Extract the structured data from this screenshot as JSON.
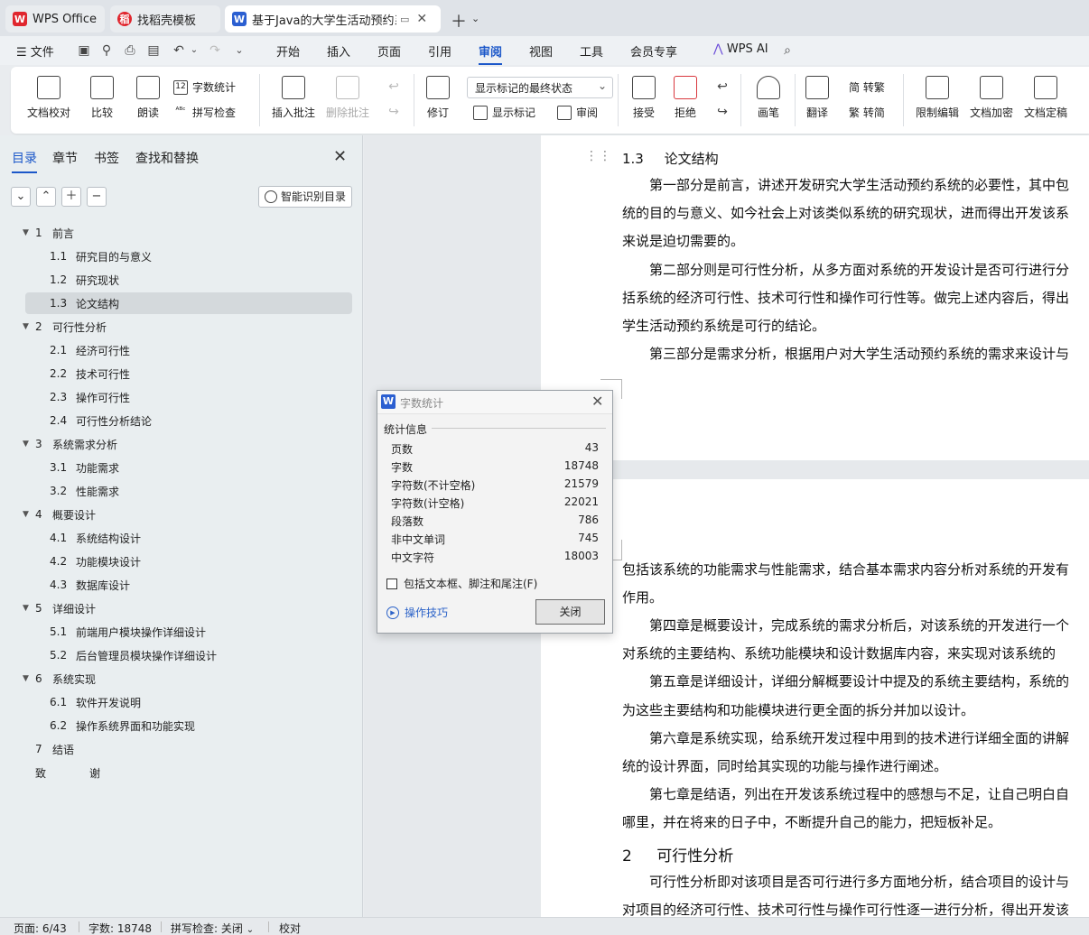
{
  "tabs": [
    {
      "label": "WPS Office",
      "icon": "wps-logo-icon"
    },
    {
      "label": "找稻壳模板",
      "icon": "docer-icon"
    },
    {
      "label": "基于Java的大学生活动预约系",
      "icon": "writer-doc-icon"
    }
  ],
  "menu": {
    "file": "文件",
    "items": [
      "开始",
      "插入",
      "页面",
      "引用",
      "审阅",
      "视图",
      "工具",
      "会员专享"
    ],
    "active": "审阅",
    "wps_ai": "WPS AI"
  },
  "ribbon": {
    "doc_check": "文档校对",
    "compare": "比较",
    "read_aloud": "朗读",
    "word_count": "字数统计",
    "spell_check": "拼写检查",
    "insert_comment": "插入批注",
    "delete_comment": "删除批注",
    "revise": "修订",
    "markup_select": "显示标记的最终状态",
    "show_markup": "显示标记",
    "review": "审阅",
    "accept": "接受",
    "reject": "拒绝",
    "pen": "画笔",
    "translate": "翻译",
    "to_traditional": "简 转繁",
    "to_simplified": "繁 转简",
    "restrict_edit": "限制编辑",
    "encrypt": "文档加密",
    "finalize": "文档定稿"
  },
  "nav": {
    "tabs": [
      "目录",
      "章节",
      "书签",
      "查找和替换"
    ],
    "smart_toc": "智能识别目录",
    "toc": [
      {
        "num": "1",
        "title": "前言",
        "level": 1,
        "expanded": true
      },
      {
        "num": "1.1",
        "title": "研究目的与意义",
        "level": 2
      },
      {
        "num": "1.2",
        "title": "研究现状",
        "level": 2
      },
      {
        "num": "1.3",
        "title": "论文结构",
        "level": 2,
        "selected": true
      },
      {
        "num": "2",
        "title": "可行性分析",
        "level": 1,
        "expanded": true
      },
      {
        "num": "2.1",
        "title": "经济可行性",
        "level": 2
      },
      {
        "num": "2.2",
        "title": "技术可行性",
        "level": 2
      },
      {
        "num": "2.3",
        "title": "操作可行性",
        "level": 2
      },
      {
        "num": "2.4",
        "title": "可行性分析结论",
        "level": 2
      },
      {
        "num": "3",
        "title": "系统需求分析",
        "level": 1,
        "expanded": true
      },
      {
        "num": "3.1",
        "title": "功能需求",
        "level": 2
      },
      {
        "num": "3.2",
        "title": "性能需求",
        "level": 2
      },
      {
        "num": "4",
        "title": "概要设计",
        "level": 1,
        "expanded": true
      },
      {
        "num": "4.1",
        "title": "系统结构设计",
        "level": 2
      },
      {
        "num": "4.2",
        "title": "功能模块设计",
        "level": 2
      },
      {
        "num": "4.3",
        "title": "数据库设计",
        "level": 2
      },
      {
        "num": "5",
        "title": "详细设计",
        "level": 1,
        "expanded": true
      },
      {
        "num": "5.1",
        "title": "前端用户模块操作详细设计",
        "level": 2
      },
      {
        "num": "5.2",
        "title": "后台管理员模块操作详细设计",
        "level": 2
      },
      {
        "num": "6",
        "title": "系统实现",
        "level": 1,
        "expanded": true
      },
      {
        "num": "6.1",
        "title": "软件开发说明",
        "level": 2
      },
      {
        "num": "6.2",
        "title": "操作系统界面和功能实现",
        "level": 2
      },
      {
        "num": "7",
        "title": "结语",
        "level": 1,
        "expanded": false
      },
      {
        "num": "致",
        "title": "谢",
        "level": 0
      }
    ]
  },
  "document": {
    "page1": {
      "heading": {
        "num": "1.3",
        "title": "论文结构"
      },
      "lines": [
        "　　第一部分是前言，讲述开发研究大学生活动预约系统的必要性，其中包",
        "统的目的与意义、如今社会上对该类似系统的研究现状，进而得出开发该系",
        "来说是迫切需要的。",
        "　　第二部分则是可行性分析，从多方面对系统的开发设计是否可行进行分",
        "括系统的经济可行性、技术可行性和操作可行性等。做完上述内容后，得出",
        "学生活动预约系统是可行的结论。",
        "　　第三部分是需求分析，根据用户对大学生活动预约系统的需求来设计与"
      ]
    },
    "page2": {
      "lines": [
        "包括该系统的功能需求与性能需求，结合基本需求内容分析对系统的开发有",
        "作用。",
        "　　第四章是概要设计，完成系统的需求分析后，对该系统的开发进行一个",
        "对系统的主要结构、系统功能模块和设计数据库内容，来实现对该系统的",
        "　　第五章是详细设计，详细分解概要设计中提及的系统主要结构，系统的",
        "为这些主要结构和功能模块进行更全面的拆分并加以设计。",
        "　　第六章是系统实现，给系统开发过程中用到的技术进行详细全面的讲解",
        "统的设计界面，同时给其实现的功能与操作进行阐述。",
        "　　第七章是结语，列出在开发该系统过程中的感想与不足，让自己明白自",
        "哪里，并在将来的日子中，不断提升自己的能力，把短板补足。"
      ],
      "heading": {
        "num": "2",
        "title": "可行性分析"
      },
      "after_lines": [
        "　　可行性分析即对该项目是否可行进行多方面地分析，结合项目的设计与",
        "对项目的经济可行性、技术可行性与操作可行性逐一进行分析，得出开发该"
      ]
    }
  },
  "dialog": {
    "title": "字数统计",
    "group": "统计信息",
    "stats": [
      {
        "label": "页数",
        "value": "43"
      },
      {
        "label": "字数",
        "value": "18748"
      },
      {
        "label": "字符数(不计空格)",
        "value": "21579"
      },
      {
        "label": "字符数(计空格)",
        "value": "22021"
      },
      {
        "label": "段落数",
        "value": "786"
      },
      {
        "label": "非中文单词",
        "value": "745"
      },
      {
        "label": "中文字符",
        "value": "18003"
      }
    ],
    "checkbox": "包括文本框、脚注和尾注(F)",
    "tips": "操作技巧",
    "close": "关闭"
  },
  "status": {
    "page": "页面: 6/43",
    "words": "字数: 18748",
    "spell": "拼写检查: 关闭",
    "proof": "校对"
  },
  "colors": {
    "accent": "#1b57c9",
    "wps_red": "#e0262e",
    "writer_blue": "#2b5fd1"
  }
}
